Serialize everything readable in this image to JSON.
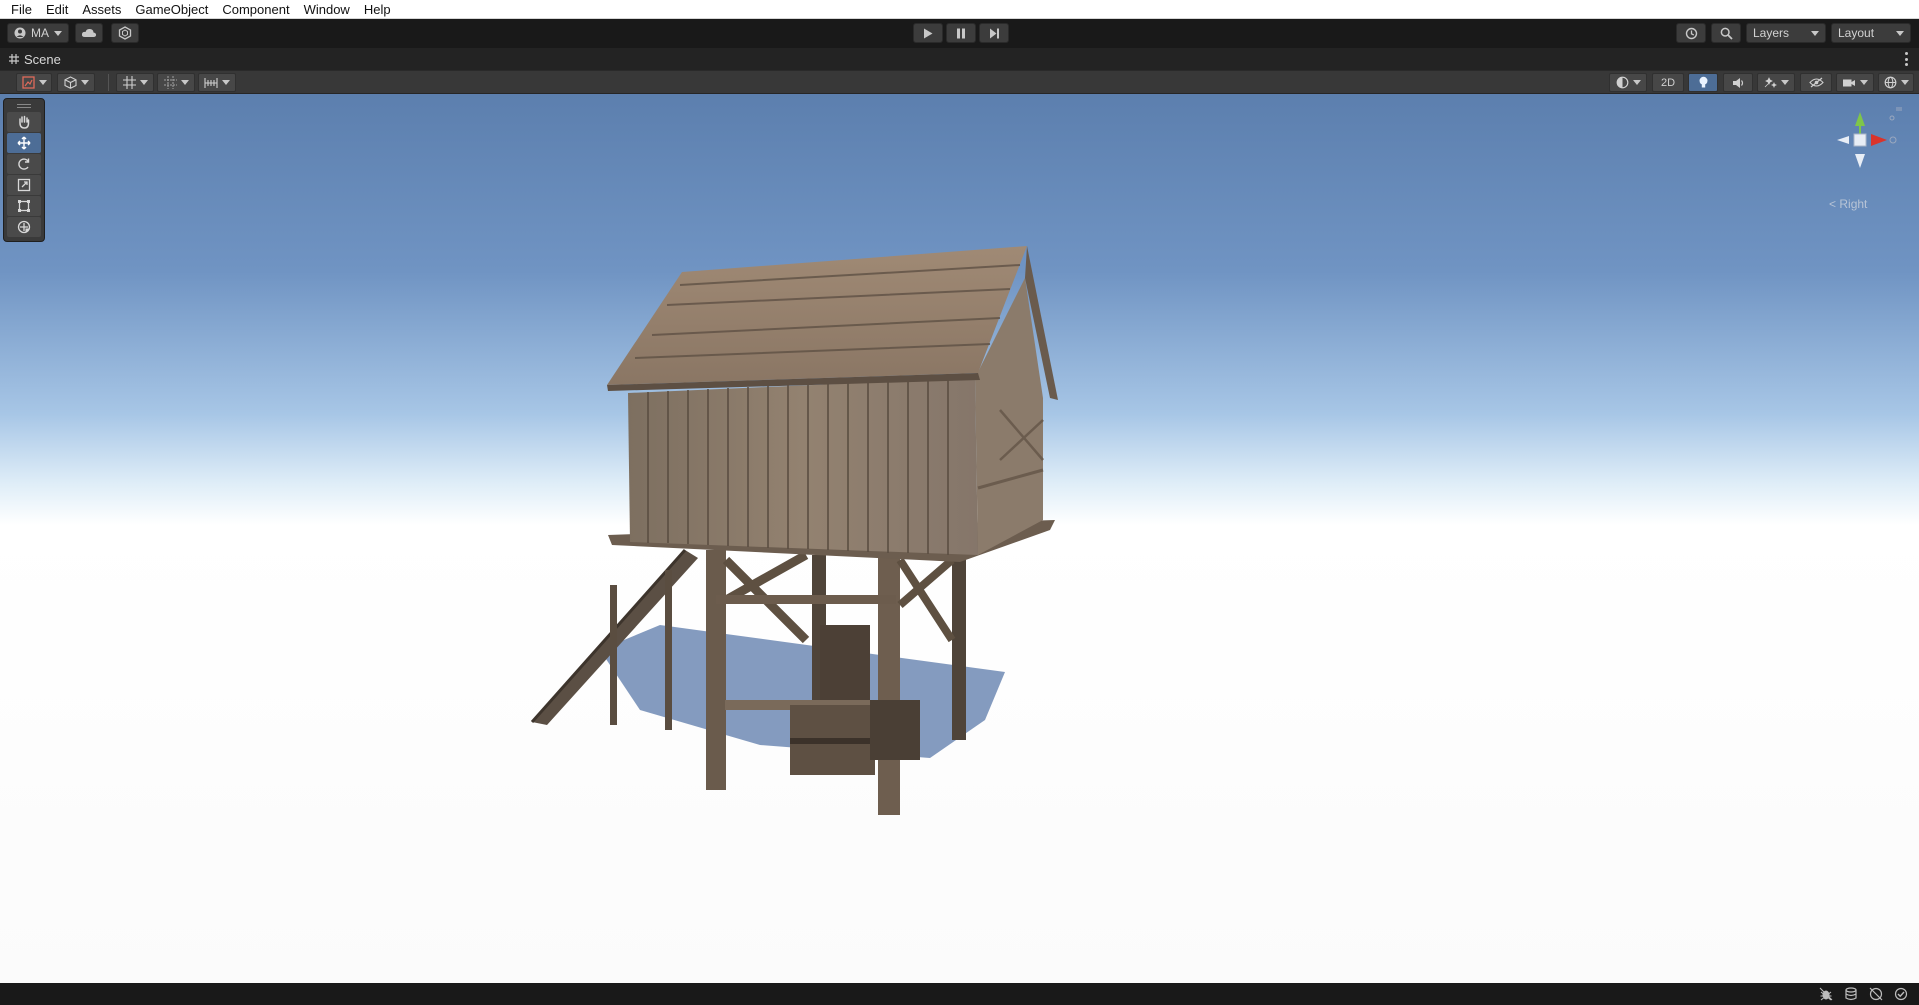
{
  "menu": [
    "File",
    "Edit",
    "Assets",
    "GameObject",
    "Component",
    "Window",
    "Help"
  ],
  "toolbar": {
    "account_label": "MA",
    "layers_label": "Layers",
    "layout_label": "Layout"
  },
  "scene_tab": {
    "label": "Scene"
  },
  "scene_toolbar": {
    "mode_2d_label": "2D"
  },
  "gizmo": {
    "view_label": "Right"
  },
  "colors": {
    "menubar_bg": "#ffffff",
    "toolbar_bg": "#191919",
    "scene_toolbar_bg": "#383838",
    "active_blue": "#4d6d96",
    "sky_top": "#5c7fae",
    "ground": "#ffffff",
    "gizmo_y": "#7fc64a",
    "gizmo_x": "#d9342b"
  },
  "icons": {
    "toolbar": [
      "account-icon",
      "cloud-icon",
      "collab-icon",
      "play-icon",
      "pause-icon",
      "step-icon",
      "history-icon",
      "search-icon"
    ],
    "tools": [
      "hand-tool-icon",
      "move-tool-icon",
      "rotate-tool-icon",
      "scale-tool-icon",
      "rect-tool-icon",
      "transform-tool-icon"
    ],
    "status": [
      "bug-icon",
      "db-icon",
      "network-icon",
      "check-icon"
    ]
  }
}
